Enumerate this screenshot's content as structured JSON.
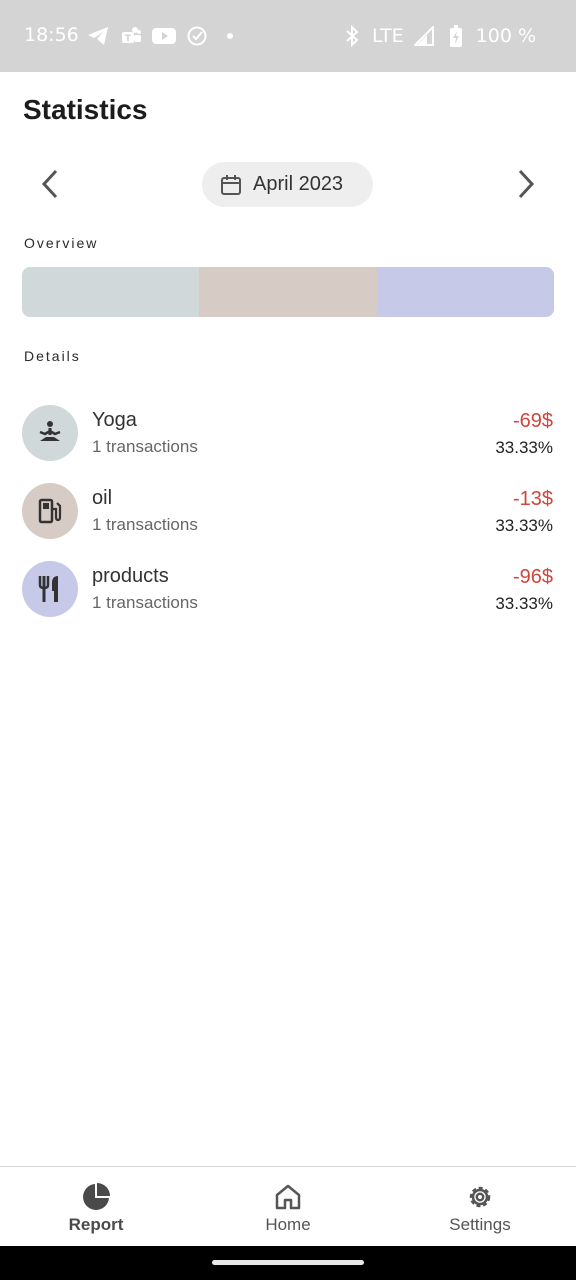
{
  "status_bar": {
    "time": "18:56",
    "network": "LTE",
    "battery": "100 %",
    "left_icons": [
      "telegram-icon",
      "teams-icon",
      "youtube-icon",
      "check-circle-icon",
      "dot-icon"
    ],
    "right_icons": [
      "bluetooth-icon",
      "signal-icon",
      "battery-icon"
    ]
  },
  "header": {
    "title": "Statistics"
  },
  "period": {
    "label": "April 2023",
    "icon": "calendar-icon"
  },
  "overview": {
    "label": "Overview",
    "segments": [
      {
        "name": "Yoga",
        "fraction": 0.3333,
        "color": "#d0d8d9"
      },
      {
        "name": "oil",
        "fraction": 0.3333,
        "color": "#d7cbc6"
      },
      {
        "name": "products",
        "fraction": 0.3334,
        "color": "#c7c9e9"
      }
    ]
  },
  "details": {
    "label": "Details",
    "items": [
      {
        "name": "Yoga",
        "transactions": "1 transactions",
        "amount": "-69$",
        "percent": "33.33%",
        "icon": "yoga-icon",
        "color": "#d0d8d9"
      },
      {
        "name": "oil",
        "transactions": "1 transactions",
        "amount": "-13$",
        "percent": "33.33%",
        "icon": "fuel-icon",
        "color": "#d7cbc6"
      },
      {
        "name": "products",
        "transactions": "1 transactions",
        "amount": "-96$",
        "percent": "33.33%",
        "icon": "restaurant-icon",
        "color": "#c7c9e9"
      }
    ]
  },
  "bottom_nav": {
    "items": [
      {
        "label": "Report",
        "icon": "pie-chart-icon",
        "active": true
      },
      {
        "label": "Home",
        "icon": "home-icon",
        "active": false
      },
      {
        "label": "Settings",
        "icon": "gear-icon",
        "active": false
      }
    ]
  },
  "colors": {
    "negative_amount": "#d0463c",
    "status_bar": "#d4d4d4"
  }
}
